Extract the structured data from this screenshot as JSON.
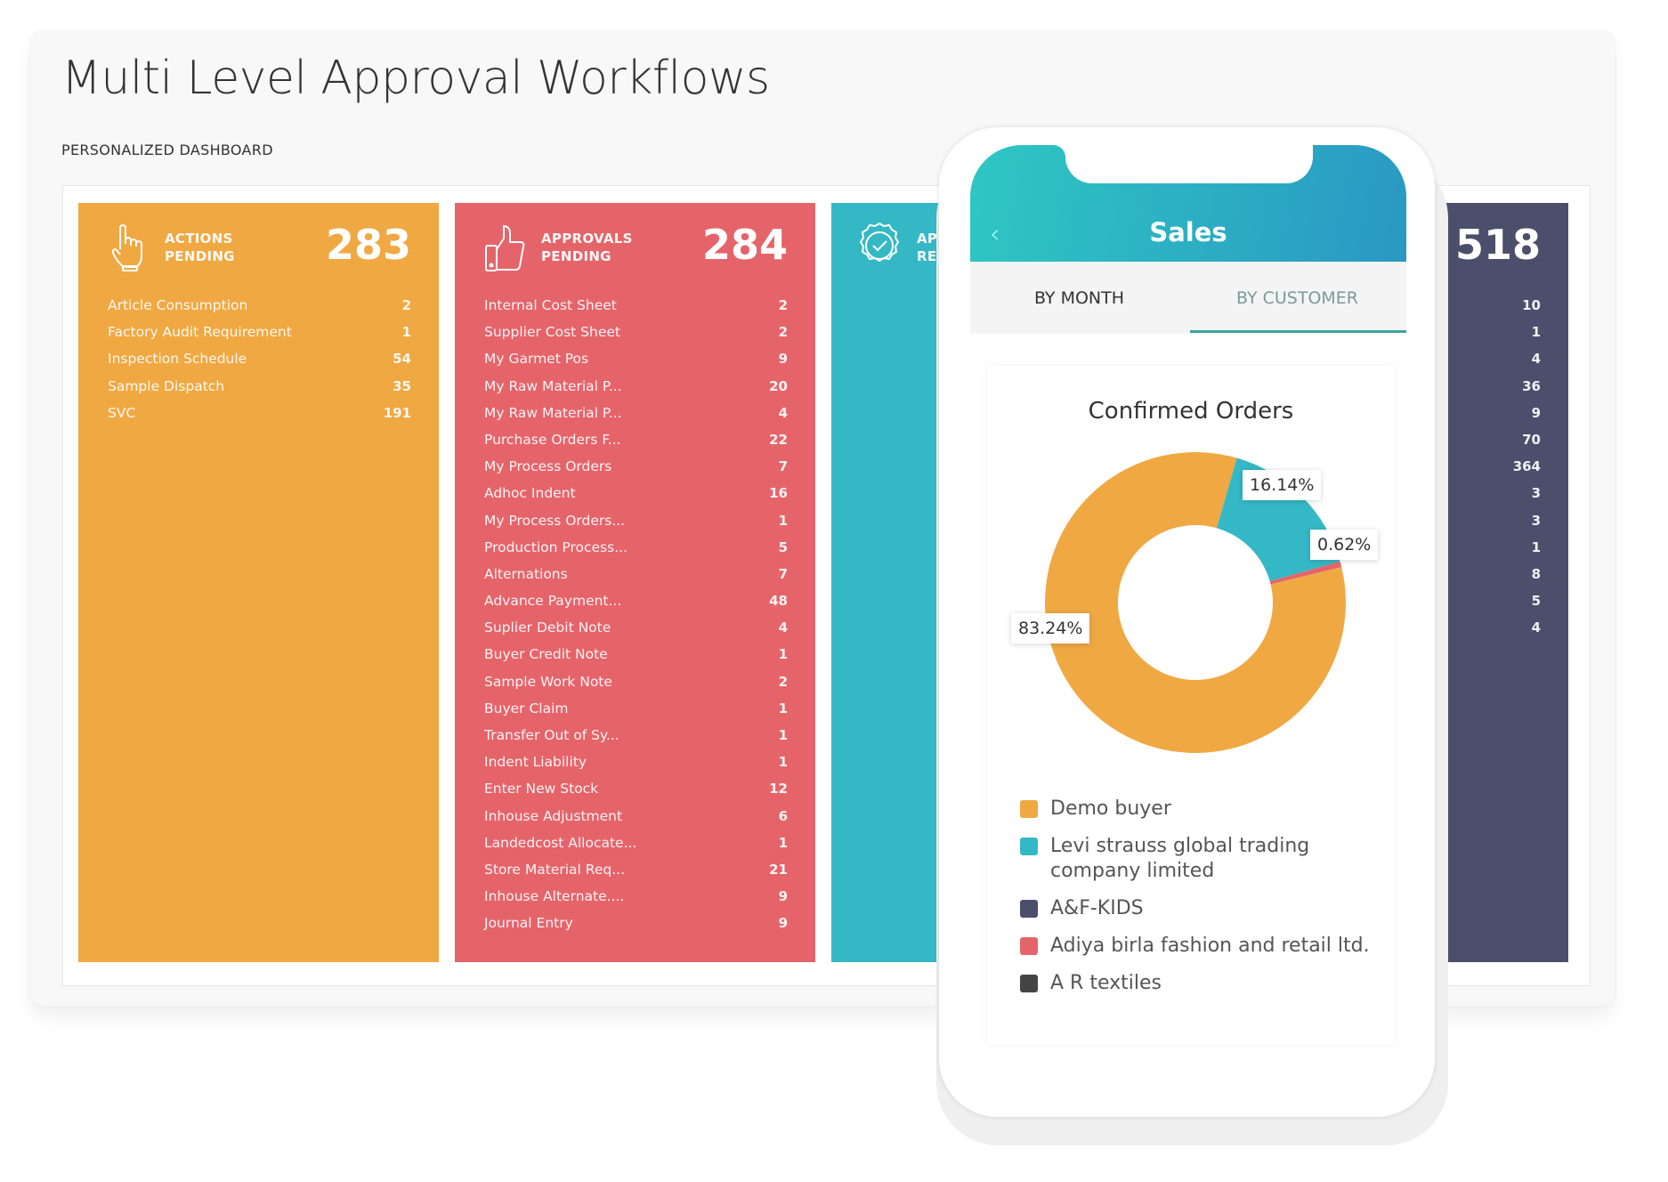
{
  "page": {
    "title": "Multi Level Approval Workflows",
    "subtitle": "PERSONALIZED DASHBOARD"
  },
  "cards": [
    {
      "label_1": "ACTIONS",
      "label_2": "PENDING",
      "total": "283",
      "color": "#f0a843",
      "icon": "hand-pointer-icon",
      "items": [
        {
          "name": "Article Consumption",
          "count": "2"
        },
        {
          "name": "Factory Audit Requirement",
          "count": "1"
        },
        {
          "name": "Inspection Schedule",
          "count": "54"
        },
        {
          "name": "Sample Dispatch",
          "count": "35"
        },
        {
          "name": "SVC",
          "count": "191"
        }
      ]
    },
    {
      "label_1": "APPROVALS",
      "label_2": "PENDING",
      "total": "284",
      "color": "#e5646a",
      "icon": "thumbs-up-icon",
      "items": [
        {
          "name": "Internal Cost Sheet",
          "count": "2"
        },
        {
          "name": "Supplier Cost Sheet",
          "count": "2"
        },
        {
          "name": "My Garmet Pos",
          "count": "9"
        },
        {
          "name": "My Raw Material P...",
          "count": "20"
        },
        {
          "name": "My Raw Material P...",
          "count": "4"
        },
        {
          "name": "Purchase Orders F...",
          "count": "22"
        },
        {
          "name": "My Process Orders",
          "count": "7"
        },
        {
          "name": "Adhoc Indent",
          "count": "16"
        },
        {
          "name": "My Process Orders...",
          "count": "1"
        },
        {
          "name": "Production Process...",
          "count": "5"
        },
        {
          "name": "Alternations",
          "count": "7"
        },
        {
          "name": "Advance Payment...",
          "count": "48"
        },
        {
          "name": "Suplier Debit Note",
          "count": "4"
        },
        {
          "name": "Buyer Credit Note",
          "count": "1"
        },
        {
          "name": "Sample Work Note",
          "count": "2"
        },
        {
          "name": "Buyer Claim",
          "count": "1"
        },
        {
          "name": "Transfer Out of Sy...",
          "count": "1"
        },
        {
          "name": "Indent Liability",
          "count": "1"
        },
        {
          "name": "Enter New Stock",
          "count": "12"
        },
        {
          "name": "Inhouse Adjustment",
          "count": "6"
        },
        {
          "name": "Landedcost Allocate...",
          "count": "1"
        },
        {
          "name": "Store Material Req...",
          "count": "21"
        },
        {
          "name": "Inhouse Alternate....",
          "count": "9"
        },
        {
          "name": "Journal Entry",
          "count": "9"
        }
      ]
    },
    {
      "label_1": "APP",
      "label_2": "REQ",
      "color": "#35b8c6",
      "icon": "badge-check-icon"
    },
    {
      "total": "518",
      "color": "#4b4f6b",
      "counts": [
        "10",
        "1",
        "4",
        "36",
        "9",
        "70",
        "364",
        "3",
        "3",
        "1",
        "8",
        "5",
        "4"
      ]
    }
  ],
  "phone": {
    "header_title": "Sales",
    "back_icon": "chevron-left-icon",
    "tabs": [
      {
        "label": "BY MONTH",
        "active": false
      },
      {
        "label": "BY CUSTOMER",
        "active": true
      }
    ],
    "accent": "#3aa4a4"
  },
  "chart_data": {
    "type": "pie",
    "title": "Confirmed Orders",
    "donut": true,
    "series": [
      {
        "name": "Demo buyer",
        "value": 83.24,
        "label": "83.24%",
        "color": "#f0a843"
      },
      {
        "name": "Levi strauss global trading company limited",
        "value": 16.14,
        "label": "16.14%",
        "color": "#35b8c6"
      },
      {
        "name": "A&F-KIDS",
        "value": 0,
        "color": "#4b4f6b"
      },
      {
        "name": "Adiya birla fashion and retail ltd.",
        "value": 0.62,
        "label": "0.62%",
        "color": "#e5646a"
      },
      {
        "name": "A R textiles",
        "value": 0,
        "color": "#444444"
      }
    ],
    "legend_position": "bottom"
  }
}
